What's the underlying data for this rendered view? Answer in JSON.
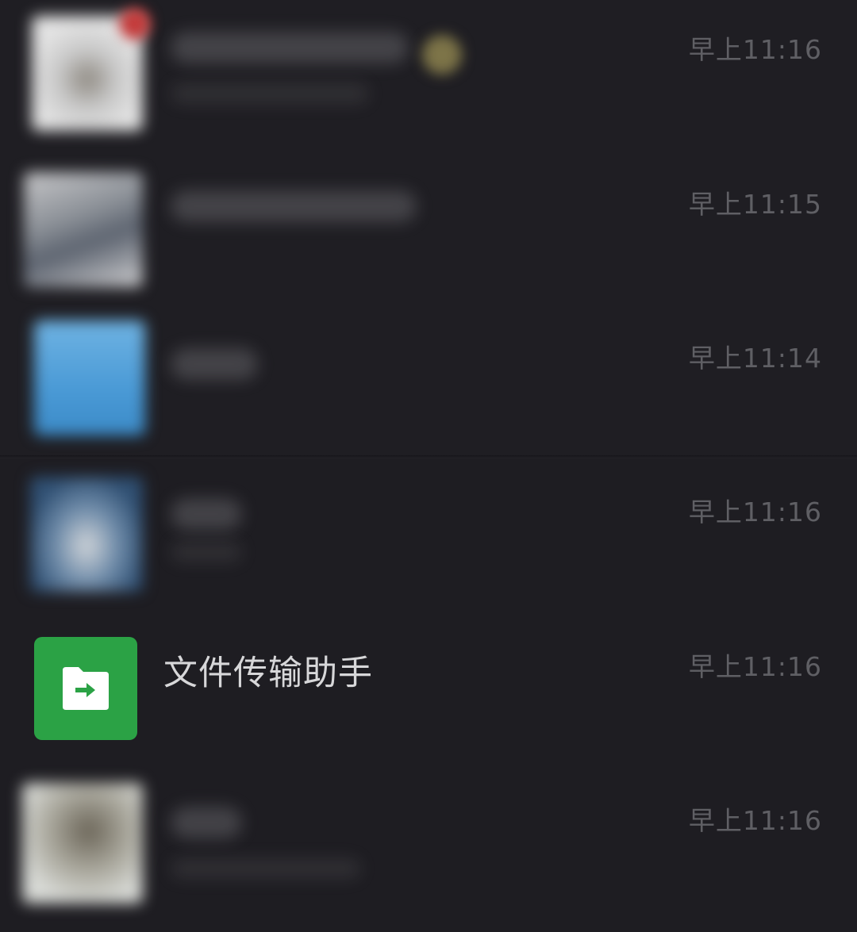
{
  "chat_list": {
    "items": [
      {
        "time": "早上11:16",
        "blurred": true,
        "avatar_color": "#cfcfcf"
      },
      {
        "time": "早上11:15",
        "blurred": true,
        "avatar_color": "#a9a9ad"
      },
      {
        "time": "早上11:14",
        "blurred": true,
        "avatar_color": "#4f9fd4"
      },
      {
        "time": "早上11:16",
        "blurred": true,
        "avatar_color": "#2f4f72"
      },
      {
        "title": "文件传输助手",
        "time": "早上11:16",
        "avatar_color": "#2ba245",
        "icon": "folder-arrow-icon"
      },
      {
        "time": "早上11:16",
        "blurred": true,
        "avatar_color": "#8c8a80"
      }
    ]
  }
}
